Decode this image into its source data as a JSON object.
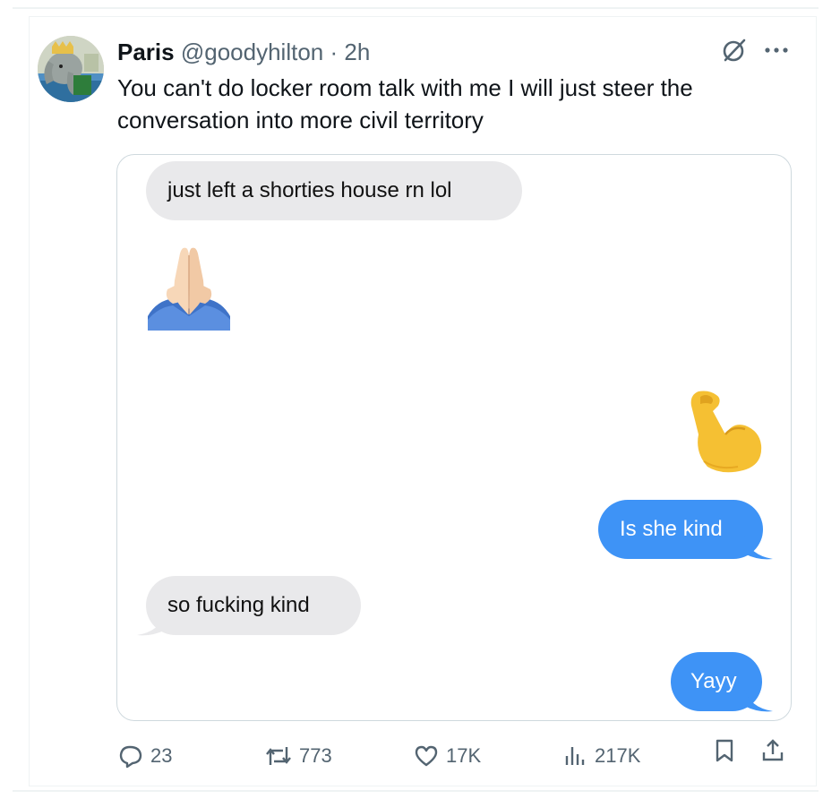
{
  "author": {
    "name": "Paris",
    "handle": "@goodyhilton",
    "separator": "·",
    "time": "2h"
  },
  "tweet": {
    "text": "You can't do locker room talk with me I will just steer the conversation into more civil territory"
  },
  "conversation": [
    {
      "from": "them",
      "kind": "text",
      "text": "just left a shorties house rn lol"
    },
    {
      "from": "them",
      "kind": "emoji",
      "icon": "folded-hands-emoji"
    },
    {
      "from": "me",
      "kind": "emoji",
      "icon": "flexed-biceps-emoji"
    },
    {
      "from": "me",
      "kind": "text",
      "text": "Is she kind"
    },
    {
      "from": "them",
      "kind": "text",
      "text": "so fucking kind"
    },
    {
      "from": "me",
      "kind": "text",
      "text": "Yayy"
    }
  ],
  "actions": {
    "replies": "23",
    "reposts": "773",
    "likes": "17K",
    "views": "217K"
  },
  "colors": {
    "text_primary": "#0f1419",
    "text_secondary": "#536471",
    "bubble_sent": "#3e93f6",
    "bubble_received": "#e9e9eb",
    "border": "#cfd9de"
  }
}
